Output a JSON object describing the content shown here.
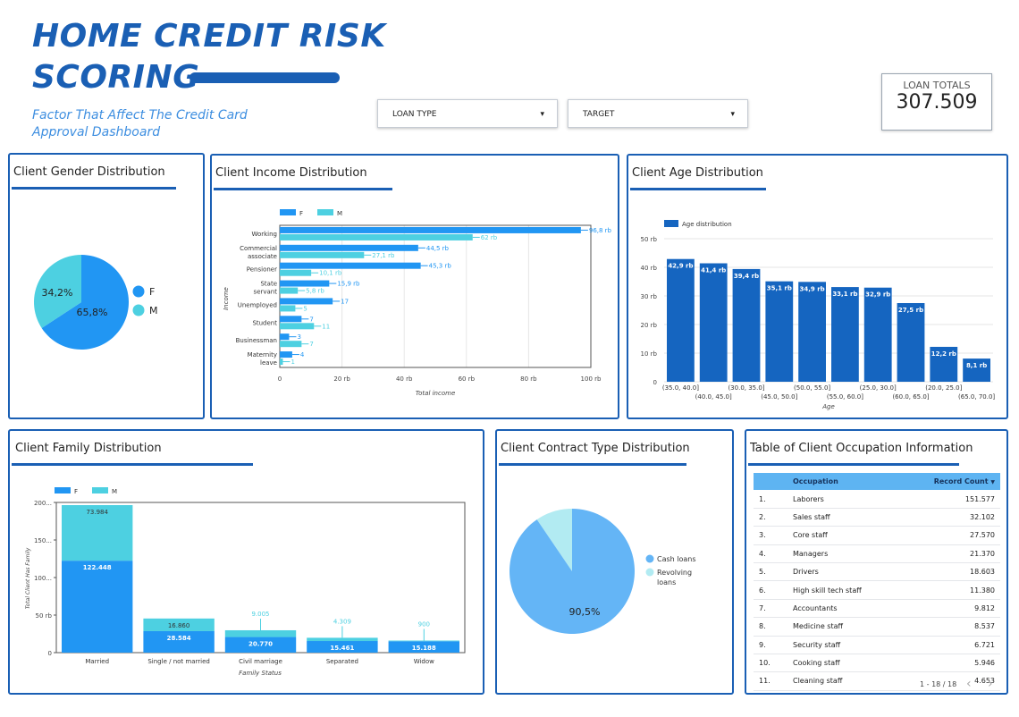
{
  "header": {
    "title_line1": "HOME CREDIT RISK",
    "title_line2": "SCORING",
    "subtitle": "Factor That Affect The Credit Card Approval Dashboard"
  },
  "filters": {
    "loan_type": "LOAN TYPE",
    "target": "TARGET"
  },
  "kpi": {
    "label": "LOAN TOTALS",
    "value": "307.509"
  },
  "colors": {
    "brand": "#1a5fb4",
    "female": "#2196f3",
    "male": "#4dd0e1",
    "age": "#1565c0",
    "cash": "#64b5f6",
    "revolving": "#b2ebf2"
  },
  "cards": {
    "gender": "Client Gender Distribution",
    "income": "Client Income Distribution",
    "age": "Client Age Distribution",
    "family": "Client Family Distribution",
    "contract": "Client Contract Type Distribution",
    "occupation": "Table of Client Occupation Information"
  },
  "chart_data": [
    {
      "id": "gender",
      "type": "pie",
      "labels": [
        "F",
        "M"
      ],
      "values": [
        65.8,
        34.2
      ],
      "data_labels": [
        "65,8%",
        "34,2%"
      ]
    },
    {
      "id": "income",
      "type": "bar",
      "orientation": "horizontal",
      "categories": [
        "Working",
        "Commercial associate",
        "Pensioner",
        "State servant",
        "Unemployed",
        "Student",
        "Businessman",
        "Maternity leave"
      ],
      "series": [
        {
          "name": "F",
          "values": [
            96.8,
            44.5,
            45.3,
            15.9,
            17,
            7,
            3,
            4
          ],
          "labels": [
            "96,8 rb",
            "44,5 rb",
            "45,3 rb",
            "15,9 rb",
            "17",
            "7",
            "3",
            "4"
          ]
        },
        {
          "name": "M",
          "values": [
            62,
            27.1,
            10.1,
            5.8,
            5,
            11,
            7,
            1
          ],
          "labels": [
            "62 rb",
            "27,1 rb",
            "10,1 rb",
            "5,8 rb",
            "5",
            "11",
            "7",
            "1"
          ]
        }
      ],
      "xlim": [
        0,
        100
      ],
      "xticks": [
        "0",
        "20 rb",
        "40 rb",
        "60 rb",
        "80 rb",
        "100 rb"
      ],
      "xlabel": "Total income",
      "ylabel": "Income",
      "legend": "top-left",
      "grid": true
    },
    {
      "id": "age",
      "type": "bar",
      "categories": [
        "(35.0, 40.0]",
        "(40.0, 45.0]",
        "(30.0, 35.0]",
        "(45.0, 50.0]",
        "(50.0, 55.0]",
        "(55.0, 60.0]",
        "(25.0, 30.0]",
        "(60.0, 65.0]",
        "(20.0, 25.0]",
        "(65.0, 70.0]"
      ],
      "series": [
        {
          "name": "Age distribution",
          "values": [
            42.9,
            41.4,
            39.4,
            35.1,
            34.9,
            33.1,
            32.9,
            27.5,
            12.2,
            8.1
          ],
          "labels": [
            "42,9 rb",
            "41,4 rb",
            "39,4 rb",
            "35,1 rb",
            "34,9 rb",
            "33,1 rb",
            "32,9 rb",
            "27,5 rb",
            "12,2 rb",
            "8,1 rb"
          ]
        }
      ],
      "ylim": [
        0,
        50
      ],
      "yticks": [
        "0",
        "10 rb",
        "20 rb",
        "30 rb",
        "40 rb",
        "50 rb"
      ],
      "xlabel": "Age",
      "legend": "top-left",
      "grid": true
    },
    {
      "id": "family",
      "type": "bar",
      "stacked": true,
      "categories": [
        "Married",
        "Single / not married",
        "Civil marriage",
        "Separated",
        "Widow"
      ],
      "series": [
        {
          "name": "F",
          "values": [
            122.448,
            28.584,
            20.77,
            15.461,
            15.188
          ],
          "labels": [
            "122.448",
            "28.584",
            "20.770",
            "15.461",
            "15.188"
          ]
        },
        {
          "name": "M",
          "values": [
            73.984,
            16.86,
            9.005,
            4.309,
            0.9
          ],
          "labels": [
            "73.984",
            "16.860",
            "9.005",
            "4.309",
            "900"
          ]
        }
      ],
      "ylim": [
        0,
        200
      ],
      "yticks": [
        "0",
        "50 rb",
        "100...",
        "150...",
        "200..."
      ],
      "xlabel": "Family Status",
      "ylabel": "Total Client Has Family",
      "legend": "top-left"
    },
    {
      "id": "contract",
      "type": "pie",
      "labels": [
        "Cash loans",
        "Revolving loans"
      ],
      "values": [
        90.5,
        9.5
      ],
      "data_labels": [
        "90,5%",
        ""
      ]
    },
    {
      "id": "occupation",
      "type": "table",
      "columns": [
        "Occupation",
        "Record Count"
      ],
      "rows": [
        [
          "1.",
          "Laborers",
          "151.577"
        ],
        [
          "2.",
          "Sales staff",
          "32.102"
        ],
        [
          "3.",
          "Core staff",
          "27.570"
        ],
        [
          "4.",
          "Managers",
          "21.370"
        ],
        [
          "5.",
          "Drivers",
          "18.603"
        ],
        [
          "6.",
          "High skill tech staff",
          "11.380"
        ],
        [
          "7.",
          "Accountants",
          "9.812"
        ],
        [
          "8.",
          "Medicine staff",
          "8.537"
        ],
        [
          "9.",
          "Security staff",
          "6.721"
        ],
        [
          "10.",
          "Cooking staff",
          "5.946"
        ],
        [
          "11.",
          "Cleaning staff",
          "4.653"
        ]
      ],
      "sort_indicator": "▼",
      "pagination": "1 - 18 / 18",
      "prev": "‹",
      "next": "›"
    }
  ]
}
